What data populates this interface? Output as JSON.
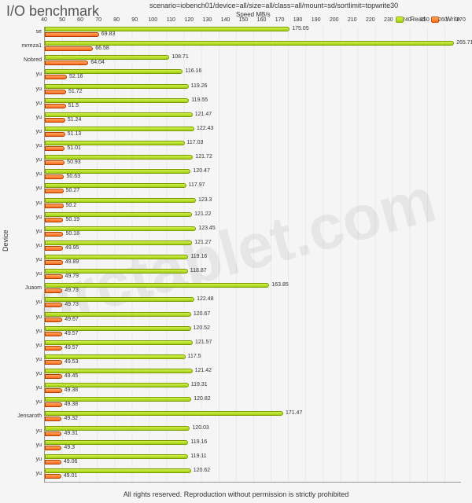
{
  "title": "I/O benchmark",
  "scenario": "scenario=iobench01/device=all/size=all/class=all/mount=sd/sortlimit=topwrite30",
  "axis_label": "Speed MB/s",
  "y_axis_label": "Device",
  "legend": {
    "read": "Read",
    "write": "Write"
  },
  "watermark": "arctablet.com",
  "footer": "All rights reserved. Reproduction without permission is strictly prohibited",
  "chart_data": {
    "type": "bar",
    "xlim": [
      40,
      270
    ],
    "xticks": [
      40,
      50,
      60,
      70,
      80,
      90,
      100,
      110,
      120,
      130,
      140,
      150,
      160,
      170,
      180,
      190,
      200,
      210,
      220,
      230,
      240,
      250,
      260,
      270
    ],
    "xlabel": "Speed MB/s",
    "ylabel": "Device",
    "series_names": [
      "Read",
      "Write"
    ],
    "rows": [
      {
        "device": "se",
        "read": 175.05,
        "write": 69.83
      },
      {
        "device": "mrreza1",
        "read": 265.71,
        "write": 66.58
      },
      {
        "device": "Nobred",
        "read": 108.71,
        "write": 64.04
      },
      {
        "device": "yu",
        "read": 116.16,
        "write": 52.16
      },
      {
        "device": "yu",
        "read": 119.26,
        "write": 51.72
      },
      {
        "device": "yu",
        "read": 119.55,
        "write": 51.5
      },
      {
        "device": "yu",
        "read": 121.47,
        "write": 51.24
      },
      {
        "device": "yu",
        "read": 122.43,
        "write": 51.13
      },
      {
        "device": "yu",
        "read": 117.03,
        "write": 51.01
      },
      {
        "device": "yu",
        "read": 121.72,
        "write": 50.93
      },
      {
        "device": "yu",
        "read": 120.47,
        "write": 50.63
      },
      {
        "device": "yu",
        "read": 117.97,
        "write": 50.27
      },
      {
        "device": "yu",
        "read": 123.3,
        "write": 50.2
      },
      {
        "device": "yu",
        "read": 121.22,
        "write": 50.19
      },
      {
        "device": "yu",
        "read": 123.45,
        "write": 50.18
      },
      {
        "device": "yu",
        "read": 121.27,
        "write": 49.95
      },
      {
        "device": "yu",
        "read": 119.16,
        "write": 49.89
      },
      {
        "device": "yu",
        "read": 118.87,
        "write": 49.79
      },
      {
        "device": "Juaom",
        "read": 163.85,
        "write": 49.73
      },
      {
        "device": "yu",
        "read": 122.48,
        "write": 49.73
      },
      {
        "device": "yu",
        "read": 120.67,
        "write": 49.67
      },
      {
        "device": "yu",
        "read": 120.52,
        "write": 49.57
      },
      {
        "device": "yu",
        "read": 121.57,
        "write": 49.57
      },
      {
        "device": "yu",
        "read": 117.5,
        "write": 49.53
      },
      {
        "device": "yu",
        "read": 121.42,
        "write": 49.45
      },
      {
        "device": "yu",
        "read": 119.31,
        "write": 49.38
      },
      {
        "device": "yu",
        "read": 120.82,
        "write": 49.38
      },
      {
        "device": "Jensaroth",
        "read": 171.47,
        "write": 49.32
      },
      {
        "device": "yu",
        "read": 120.03,
        "write": 49.31
      },
      {
        "device": "yu",
        "read": 119.16,
        "write": 49.3
      },
      {
        "device": "yu",
        "read": 119.11,
        "write": 49.06
      },
      {
        "device": "yu",
        "read": 120.62,
        "write": 49.01
      }
    ]
  }
}
